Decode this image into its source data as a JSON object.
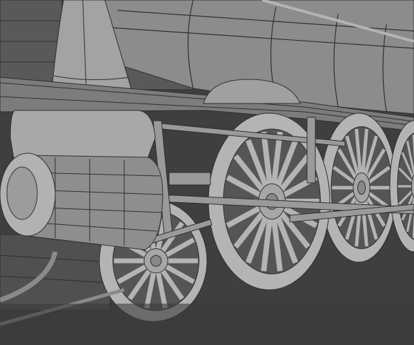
{
  "viewport": {
    "background_color": "#3f3f3f",
    "wall_color": "#595959",
    "mesh_color": "#8c8c8c",
    "mesh_light": "#b4b4b4",
    "mesh_dark": "#6a6a6a",
    "wire_color": "#2e2e2e"
  },
  "wheels": [
    {
      "name": "pilot-wheel",
      "spokes": 14
    },
    {
      "name": "driver-wheel-1",
      "spokes": 18
    },
    {
      "name": "driver-wheel-2",
      "spokes": 18
    },
    {
      "name": "driver-wheel-3",
      "spokes": 18
    }
  ]
}
